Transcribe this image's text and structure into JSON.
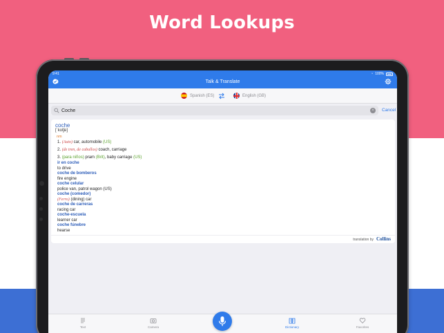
{
  "headline": "Word Lookups",
  "colors": {
    "pink": "#f1607f",
    "blue": "#3d6fd4",
    "accent": "#2f7bea",
    "headword": "#2a5bb8"
  },
  "status": {
    "time": "9:41",
    "battery": "100%"
  },
  "navbar": {
    "title": "Talk & Translate",
    "left_icon": "pro-badge-icon",
    "right_icon": "gear-icon"
  },
  "languages": {
    "source": "Spanish (ES)",
    "target": "English (GB)",
    "swap_icon": "swap-arrows-icon"
  },
  "search": {
    "value": "Coche",
    "cancel": "Cancel"
  },
  "entry": {
    "headword": "coche",
    "pronunciation": "[ˈkotʃe]",
    "pos": "nm",
    "senses": [
      {
        "num": "1.",
        "label": "(Auto)",
        "text": " car, automobile ",
        "region": "(US)"
      },
      {
        "num": "2.",
        "label": "(de tren, de caballos)",
        "text": " coach, carriage",
        "region": ""
      },
      {
        "num": "3.",
        "label": "(para niños)",
        "text": " pram ",
        "region": "(Brit)",
        "text2": ", baby carriage ",
        "region2": "(US)"
      }
    ],
    "phrases": [
      {
        "phrase": "ir en coche",
        "translation": "to drive"
      },
      {
        "phrase": "coche de bomberos",
        "translation": "fire engine"
      },
      {
        "phrase": "coche celular",
        "translation": "police van, patrol wagon (US)"
      },
      {
        "phrase": "coche (comedor)",
        "translation_label": "(Ferro)",
        "translation": " (dining) car"
      },
      {
        "phrase": "coche de carreras",
        "translation": "racing car"
      },
      {
        "phrase": "coche-escuela",
        "translation": "learner car"
      },
      {
        "phrase": "coche fúnebre",
        "translation": "hearse"
      }
    ],
    "credit_text": "translation by",
    "credit_brand": "Collins"
  },
  "tabs": [
    {
      "label": "Text",
      "icon": "text-lines-icon"
    },
    {
      "label": "Camera",
      "icon": "camera-icon"
    },
    {
      "label": "Dictionary",
      "icon": "dictionary-book-icon",
      "active": true
    },
    {
      "label": "Favorites",
      "icon": "heart-icon"
    }
  ],
  "mic_icon": "microphone-icon"
}
